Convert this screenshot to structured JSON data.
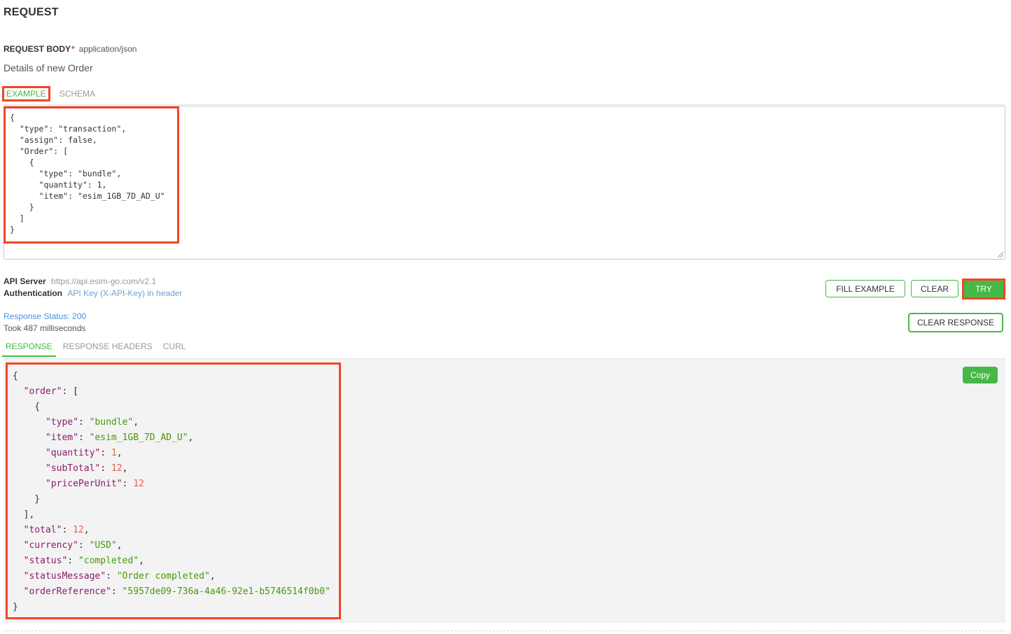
{
  "section_title": "REQUEST",
  "request_body": {
    "label": "REQUEST BODY",
    "required_mark": "*",
    "content_type": "application/json",
    "description": "Details of new Order"
  },
  "request_tabs": {
    "example": "EXAMPLE",
    "schema": "SCHEMA"
  },
  "request_example_lines": [
    "{",
    "  \"type\": \"transaction\",",
    "  \"assign\": false,",
    "  \"Order\": [",
    "    {",
    "      \"type\": \"bundle\",",
    "      \"quantity\": 1,",
    "      \"item\": \"esim_1GB_7D_AD_U\"",
    "    }",
    "  ]",
    "}"
  ],
  "api_server": {
    "label": "API Server",
    "url": "https://api.esim-go.com/v2.1"
  },
  "authentication": {
    "label": "Authentication",
    "value": "API Key (X-API-Key) in header"
  },
  "buttons": {
    "fill_example": "FILL EXAMPLE",
    "clear": "CLEAR",
    "try": "TRY",
    "clear_response": "CLEAR RESPONSE",
    "copy": "Copy"
  },
  "response_meta": {
    "status": "Response Status: 200",
    "took": "Took 487 milliseconds"
  },
  "response_tabs": {
    "response": "RESPONSE",
    "headers": "RESPONSE HEADERS",
    "curl": "CURL"
  },
  "response_lines": [
    [
      {
        "t": "p",
        "v": "{"
      }
    ],
    [
      {
        "t": "p",
        "v": "  "
      },
      {
        "t": "k",
        "v": "\"order\""
      },
      {
        "t": "p",
        "v": ": ["
      }
    ],
    [
      {
        "t": "p",
        "v": "    {"
      }
    ],
    [
      {
        "t": "p",
        "v": "      "
      },
      {
        "t": "k",
        "v": "\"type\""
      },
      {
        "t": "p",
        "v": ": "
      },
      {
        "t": "s",
        "v": "\"bundle\""
      },
      {
        "t": "p",
        "v": ","
      }
    ],
    [
      {
        "t": "p",
        "v": "      "
      },
      {
        "t": "k",
        "v": "\"item\""
      },
      {
        "t": "p",
        "v": ": "
      },
      {
        "t": "s",
        "v": "\"esim_1GB_7D_AD_U\""
      },
      {
        "t": "p",
        "v": ","
      }
    ],
    [
      {
        "t": "p",
        "v": "      "
      },
      {
        "t": "k",
        "v": "\"quantity\""
      },
      {
        "t": "p",
        "v": ": "
      },
      {
        "t": "n",
        "v": "1"
      },
      {
        "t": "p",
        "v": ","
      }
    ],
    [
      {
        "t": "p",
        "v": "      "
      },
      {
        "t": "k",
        "v": "\"subTotal\""
      },
      {
        "t": "p",
        "v": ": "
      },
      {
        "t": "n",
        "v": "12"
      },
      {
        "t": "p",
        "v": ","
      }
    ],
    [
      {
        "t": "p",
        "v": "      "
      },
      {
        "t": "k",
        "v": "\"pricePerUnit\""
      },
      {
        "t": "p",
        "v": ": "
      },
      {
        "t": "n",
        "v": "12"
      }
    ],
    [
      {
        "t": "p",
        "v": "    }"
      }
    ],
    [
      {
        "t": "p",
        "v": "  ],"
      }
    ],
    [
      {
        "t": "p",
        "v": "  "
      },
      {
        "t": "k",
        "v": "\"total\""
      },
      {
        "t": "p",
        "v": ": "
      },
      {
        "t": "n",
        "v": "12"
      },
      {
        "t": "p",
        "v": ","
      }
    ],
    [
      {
        "t": "p",
        "v": "  "
      },
      {
        "t": "k",
        "v": "\"currency\""
      },
      {
        "t": "p",
        "v": ": "
      },
      {
        "t": "s",
        "v": "\"USD\""
      },
      {
        "t": "p",
        "v": ","
      }
    ],
    [
      {
        "t": "p",
        "v": "  "
      },
      {
        "t": "k",
        "v": "\"status\""
      },
      {
        "t": "p",
        "v": ": "
      },
      {
        "t": "s",
        "v": "\"completed\""
      },
      {
        "t": "p",
        "v": ","
      }
    ],
    [
      {
        "t": "p",
        "v": "  "
      },
      {
        "t": "k",
        "v": "\"statusMessage\""
      },
      {
        "t": "p",
        "v": ": "
      },
      {
        "t": "s",
        "v": "\"Order completed\""
      },
      {
        "t": "p",
        "v": ","
      }
    ],
    [
      {
        "t": "p",
        "v": "  "
      },
      {
        "t": "k",
        "v": "\"orderReference\""
      },
      {
        "t": "p",
        "v": ": "
      },
      {
        "t": "s",
        "v": "\"5957de09-736a-4a46-92e1-b5746514f0b0\""
      }
    ],
    [
      {
        "t": "p",
        "v": "}"
      }
    ]
  ],
  "colors": {
    "accent_green": "#47b847",
    "highlight_red": "#f24527",
    "link_blue": "#4a90d9",
    "json_key": "#8a1c6e",
    "json_string": "#48980a",
    "json_number": "#e5604a"
  }
}
